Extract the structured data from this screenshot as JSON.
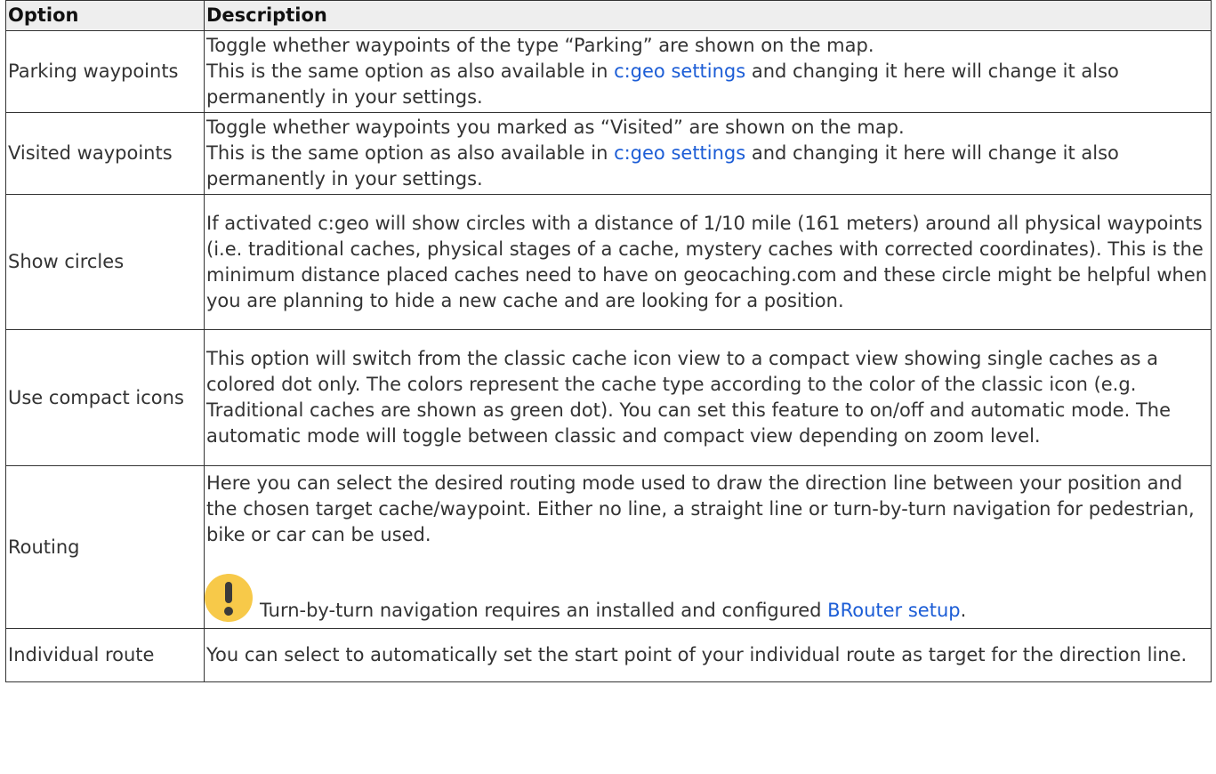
{
  "table": {
    "headers": [
      "Option",
      "Description"
    ],
    "rows": [
      {
        "option": "Parking waypoints",
        "line1": "Toggle whether waypoints of the type “Parking” are shown on the map.",
        "line2_pre": "This is the same option as also available in ",
        "line2_link": "c:geo settings",
        "line2_post": " and changing it here will change it also permanently in your settings."
      },
      {
        "option": "Visited waypoints",
        "line1": "Toggle whether waypoints you marked as “Visited” are shown on the map.",
        "line2_pre": "This is the same option as also available in ",
        "line2_link": "c:geo settings",
        "line2_post": " and changing it here will change it also permanently in your settings."
      },
      {
        "option": "Show circles",
        "text": "If activated c:geo will show circles with a distance of 1/10 mile (161 meters) around all physical waypoints (i.e. traditional caches, physical stages of a cache, mystery caches with corrected coordinates). This is the minimum distance placed caches need to have on geocaching.com and these circle might be helpful when you are planning to hide a new cache and are looking for a position."
      },
      {
        "option": "Use compact icons",
        "text": "This option will switch from the classic cache icon view to a compact view showing single caches as a colored dot only. The colors represent the cache type according to the color of the classic icon (e.g. Traditional caches are shown as green dot). You can set this feature to on/off and automatic mode. The automatic mode will toggle between classic and compact view depending on zoom level."
      },
      {
        "option": "Routing",
        "text": "Here you can select the desired routing mode used to draw the direction line between your position and the chosen target cache/waypoint. Either no line, a straight line or turn-by-turn navigation for pedestrian, bike or car can be used.",
        "note_icon": "warning-exclamation-icon",
        "note_pre": "Turn-by-turn navigation requires an installed and configured ",
        "note_link": "BRouter setup",
        "note_post": "."
      },
      {
        "option": "Individual route",
        "text": "You can select to automatically set the start point of your individual route as target for the direction line."
      }
    ]
  },
  "colors": {
    "link": "#1c5dd6",
    "header_bg": "#eeeeee",
    "border": "#333333",
    "note_icon": "#f7c949"
  }
}
